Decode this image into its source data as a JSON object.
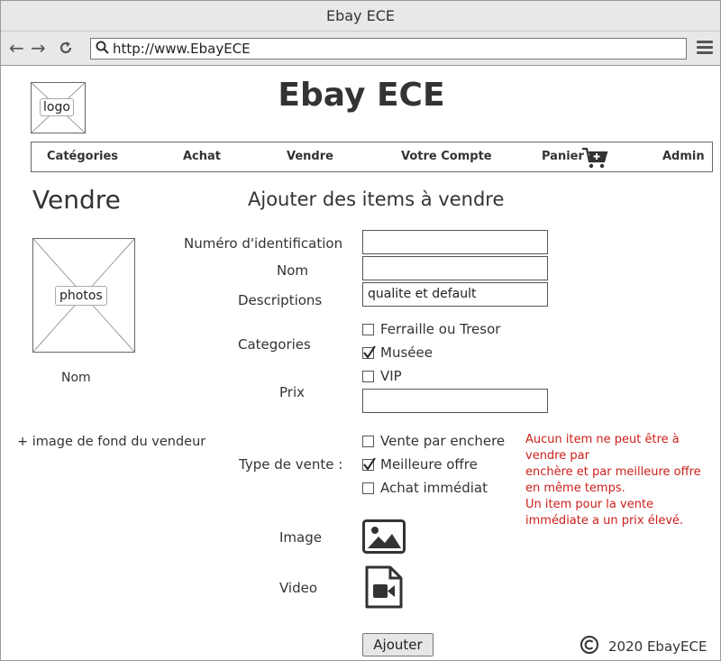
{
  "window": {
    "title": "Ebay ECE"
  },
  "browser": {
    "url": "http://www.EbayECE",
    "back_icon": "arrow-left-icon",
    "forward_icon": "arrow-right-icon",
    "refresh_icon": "refresh-icon",
    "menu_icon": "hamburger-menu-icon"
  },
  "header": {
    "logo_label": "logo",
    "site_title": "Ebay ECE"
  },
  "menu": {
    "items": [
      "Catégories",
      "Achat",
      "Vendre",
      "Votre Compte",
      "Panier",
      "Admin"
    ]
  },
  "page": {
    "heading": "Vendre",
    "section_heading": "Ajouter des items à vendre"
  },
  "seller": {
    "photo_label": "photos",
    "name_label": "Nom",
    "background_note": "+ image de fond du vendeur"
  },
  "form": {
    "id_label": "Numéro d'identification",
    "id_value": "",
    "name_label": "Nom",
    "name_value": "",
    "description_label": "Descriptions",
    "description_value": "qualite et default",
    "categories_label": "Categories",
    "categories": [
      {
        "label": "Ferraille ou Tresor",
        "checked": false
      },
      {
        "label": "Muséee",
        "checked": true
      },
      {
        "label": "VIP",
        "checked": false
      }
    ],
    "price_label": "Prix",
    "price_value": "",
    "sale_type_label": "Type de vente :",
    "sale_types": [
      {
        "label": "Vente par enchere",
        "checked": false
      },
      {
        "label": "Meilleure offre",
        "checked": true
      },
      {
        "label": "Achat immédiat",
        "checked": false
      }
    ],
    "image_label": "Image",
    "video_label": "Video",
    "submit_label": "Ajouter"
  },
  "note": {
    "lines": [
      "Aucun item ne peut être à",
      "vendre par",
      "enchère et par meilleure offre",
      "en même temps.",
      "Un item pour la vente",
      "immédiate a un prix élevé."
    ],
    "color": "#cc1f1a"
  },
  "footer": {
    "text": "2020 EbayECE"
  }
}
